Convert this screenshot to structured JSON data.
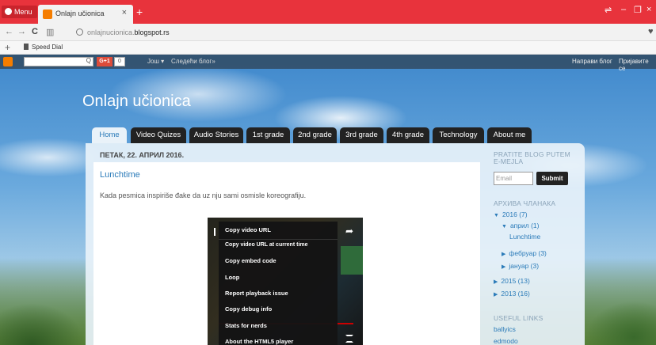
{
  "browser": {
    "menu_label": "Menu",
    "tab_title": "Onlajn učionica",
    "tab_close": "×",
    "new_tab": "+",
    "url_prefix": "onlajnucionica.",
    "url_host": "blogspot.rs",
    "bookmark": "Speed Dial",
    "window_controls": [
      "⇌",
      "–",
      "❐",
      "×"
    ]
  },
  "blogger_bar": {
    "search_glyph": "Q",
    "gplus_label": "G+1",
    "gplus_count": "0",
    "more_label": "Још ▾",
    "next_blog": "Следећи блог»",
    "create_blog": "Направи блог",
    "sign_in": "Пријавите се"
  },
  "blog": {
    "title": "Onlajn učionica",
    "tabs": [
      "Home",
      "Video Quizes",
      "Audio Stories",
      "1st grade",
      "2nd grade",
      "3rd grade",
      "4th grade",
      "Technology",
      "About me"
    ],
    "active_tab": "Home"
  },
  "post": {
    "date": "ПЕТАК, 22. АПРИЛ 2016.",
    "title": "Lunchtime",
    "text": "Kada pesmica inspiriše đake da uz nju sami osmisle koreografiju."
  },
  "video_context_menu": {
    "items": [
      "Copy video URL",
      "Copy video URL at current time",
      "Copy embed code",
      "Loop",
      "Report playback issue",
      "Copy debug info",
      "Stats for nerds",
      "About the HTML5 player"
    ]
  },
  "sidebar": {
    "follow_heading": "PRATITE BLOG PUTEM E-MEJLA",
    "email_placeholder": "Email addres",
    "submit_label": "Submit",
    "archive_heading": "АРХИВА ЧЛАНАКА",
    "archive": [
      {
        "label": "2016 (7)",
        "expanded": true
      },
      {
        "label": "април (1)",
        "expanded": true
      },
      {
        "label": "Lunchtime"
      },
      {
        "label": "фебруар (3)",
        "expanded": false
      },
      {
        "label": "јануар (3)",
        "expanded": false
      },
      {
        "label": "2015 (13)",
        "expanded": false
      },
      {
        "label": "2013 (16)",
        "expanded": false
      }
    ],
    "links_heading": "USEFUL LINKS",
    "links": [
      "ballyics",
      "edmodo"
    ]
  },
  "colors": {
    "browser_red": "#e8333c",
    "link_blue": "#2b7bb9",
    "tab_dark": "#222222"
  }
}
